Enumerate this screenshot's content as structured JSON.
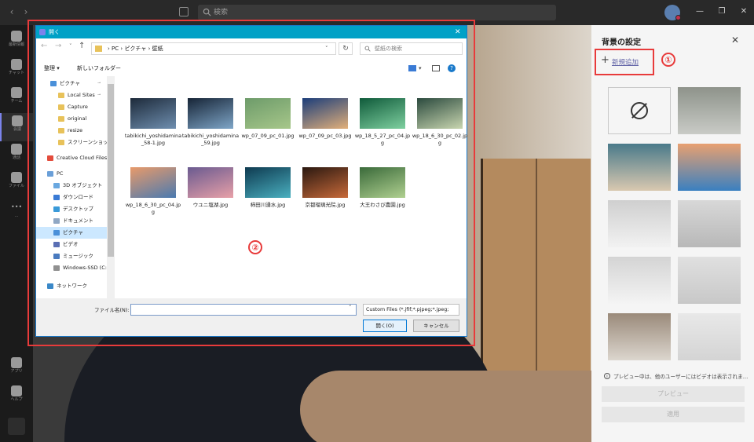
{
  "teams": {
    "search_placeholder": "検索",
    "rail": [
      {
        "label": "最新情報",
        "icon": "bell-icon"
      },
      {
        "label": "チャット",
        "icon": "chat-icon"
      },
      {
        "label": "チーム",
        "icon": "teams-icon"
      },
      {
        "label": "会議",
        "icon": "calendar-icon"
      },
      {
        "label": "通話",
        "icon": "phone-icon"
      },
      {
        "label": "ファイル",
        "icon": "file-icon"
      },
      {
        "label": "…",
        "icon": "more-icon"
      },
      {
        "label": "アプリ",
        "icon": "apps-icon"
      },
      {
        "label": "ヘルプ",
        "icon": "help-icon"
      }
    ]
  },
  "dialog": {
    "title": "開く",
    "path": [
      "PC",
      "ピクチャ",
      "壁紙"
    ],
    "search_placeholder": "壁紙の検索",
    "organize": "整理",
    "new_folder": "新しいフォルダー",
    "nav": [
      {
        "label": "ピクチャ",
        "color": "#4a90d9",
        "pin": "📌"
      },
      {
        "label": "Local Sites",
        "color": "#e8c25a",
        "pin": "📌"
      },
      {
        "label": "Capture",
        "color": "#e8c25a",
        "pin": ""
      },
      {
        "label": "original",
        "color": "#e8c25a",
        "pin": ""
      },
      {
        "label": "resize",
        "color": "#e8c25a",
        "pin": ""
      },
      {
        "label": "スクリーンショット",
        "color": "#e8c25a",
        "pin": ""
      },
      {
        "label": "Creative Cloud Files",
        "color": "#e34c3c",
        "pin": ""
      },
      {
        "label": "PC",
        "color": "#6a9fd8",
        "pin": ""
      },
      {
        "label": "3D オブジェクト",
        "color": "#6aa8e0",
        "pin": ""
      },
      {
        "label": "ダウンロード",
        "color": "#3a7bd5",
        "pin": ""
      },
      {
        "label": "デスクトップ",
        "color": "#3a9ad9",
        "pin": ""
      },
      {
        "label": "ドキュメント",
        "color": "#8fa7c4",
        "pin": ""
      },
      {
        "label": "ピクチャ",
        "color": "#4a90d9",
        "pin": ""
      },
      {
        "label": "ビデオ",
        "color": "#5a6fb4",
        "pin": ""
      },
      {
        "label": "ミュージック",
        "color": "#4a7bbf",
        "pin": ""
      },
      {
        "label": "Windows-SSD (C:)",
        "color": "#909090",
        "pin": ""
      },
      {
        "label": "ネットワーク",
        "color": "#3a88c8",
        "pin": ""
      }
    ],
    "files": [
      {
        "name": "tabikichi_yoshidamina_58-1.jpg",
        "colors": [
          "#1d2a3a",
          "#6f8fb0"
        ]
      },
      {
        "name": "tabikichi_yoshidamina_59.jpg",
        "colors": [
          "#162436",
          "#7fa6c8"
        ]
      },
      {
        "name": "wp_07_09_pc_01.jpg",
        "colors": [
          "#6d9b6a",
          "#a7c78a"
        ]
      },
      {
        "name": "wp_07_09_pc_03.jpg",
        "colors": [
          "#1b3d7a",
          "#e2b07a"
        ]
      },
      {
        "name": "wp_18_5_27_pc_04.jpg",
        "colors": [
          "#0f5a3a",
          "#7fd0a0"
        ]
      },
      {
        "name": "wp_18_6_30_pc_02.jpg",
        "colors": [
          "#2b4a3e",
          "#c9d6b0"
        ]
      },
      {
        "name": "wp_18_6_30_pc_04.jpg",
        "colors": [
          "#e89a6a",
          "#4a7ab0"
        ]
      },
      {
        "name": "ウユニ塩湖.jpg",
        "colors": [
          "#6a5a90",
          "#e8a0a8"
        ]
      },
      {
        "name": "柿田川湧水.jpg",
        "colors": [
          "#0e3a50",
          "#4ab0c0"
        ]
      },
      {
        "name": "京都瑠璃光院.jpg",
        "colors": [
          "#2a1810",
          "#c86a3a"
        ]
      },
      {
        "name": "大王わさび農園.jpg",
        "colors": [
          "#3a6a3a",
          "#b0d090"
        ]
      }
    ],
    "filename_label": "ファイル名(N):",
    "filename_value": "",
    "filetype": "Custom Files (*.jfif;*.pjpeg;*.jpeg;",
    "open_label": "開く(O)",
    "cancel_label": "キャンセル"
  },
  "panel": {
    "title": "背景の設定",
    "add_new": "新規追加",
    "preview_note": "プレビュー中は、他のユーザーにはビデオは表示されま…",
    "preview_label": "プレビュー",
    "apply_label": "適用",
    "backgrounds": [
      {
        "name": "none",
        "colors": [
          "#f5f5f5",
          "#f5f5f5"
        ]
      },
      {
        "name": "blur",
        "colors": [
          "#8e938a",
          "#c9cbc6"
        ]
      },
      {
        "name": "office-blue",
        "colors": [
          "#4a7a8a",
          "#d9c8b0"
        ]
      },
      {
        "name": "beach",
        "colors": [
          "#e8a070",
          "#3a80c0"
        ]
      },
      {
        "name": "white-room-1",
        "colors": [
          "#cfcfcf",
          "#f2f2f2"
        ]
      },
      {
        "name": "white-room-2",
        "colors": [
          "#d8d8d8",
          "#b8b8b8"
        ]
      },
      {
        "name": "white-room-3",
        "colors": [
          "#d4d4d4",
          "#f4f4f4"
        ]
      },
      {
        "name": "white-room-4",
        "colors": [
          "#e0e0e0",
          "#c8c8c8"
        ]
      },
      {
        "name": "loft",
        "colors": [
          "#9a8a7a",
          "#dcd6ce"
        ]
      },
      {
        "name": "white-room-5",
        "colors": [
          "#e8e8e8",
          "#d4d4d4"
        ]
      }
    ]
  },
  "annotations": {
    "one": "①",
    "two": "②"
  }
}
